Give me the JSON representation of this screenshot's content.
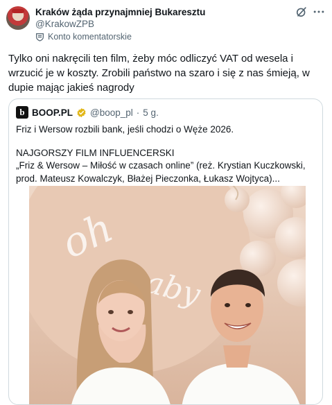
{
  "tweet": {
    "author_name": "Kraków żąda przynajmniej Bukaresztu",
    "author_handle": "@KrakowZPB",
    "account_label": "Konto komentatorskie",
    "text": "Tylko oni nakręcili ten film, żeby móc odliczyć VAT od wesela i wrzucić je w koszty. Zrobili państwo na szaro i się z nas śmieją, w dupie mając jakieś nagrody"
  },
  "quote": {
    "logo_letter": "b",
    "name": "BOOP.PL",
    "handle": "@boop_pl",
    "separator": "·",
    "time": "5 g.",
    "line1": "Friz i Wersow rozbili bank, jeśli chodzi o Węże 2026.",
    "line2": "NAJGORSZY FILM INFLUENCERSKI",
    "line3": "„Friz & Wersow – Miłość w czasach online” (reż. Krystian Kuczkowski, prod. Mateusz Kowalczyk, Błażej Pieczonka, Łukasz Wojtyca)..."
  },
  "icons": {
    "grok": "grok-icon",
    "more": "more-icon",
    "account": "badge-icon",
    "verified": "verified-gold-icon"
  },
  "colors": {
    "text_primary": "#0f1419",
    "text_secondary": "#536471",
    "border": "#cfd9de",
    "verified_gold": "#e2b719"
  }
}
